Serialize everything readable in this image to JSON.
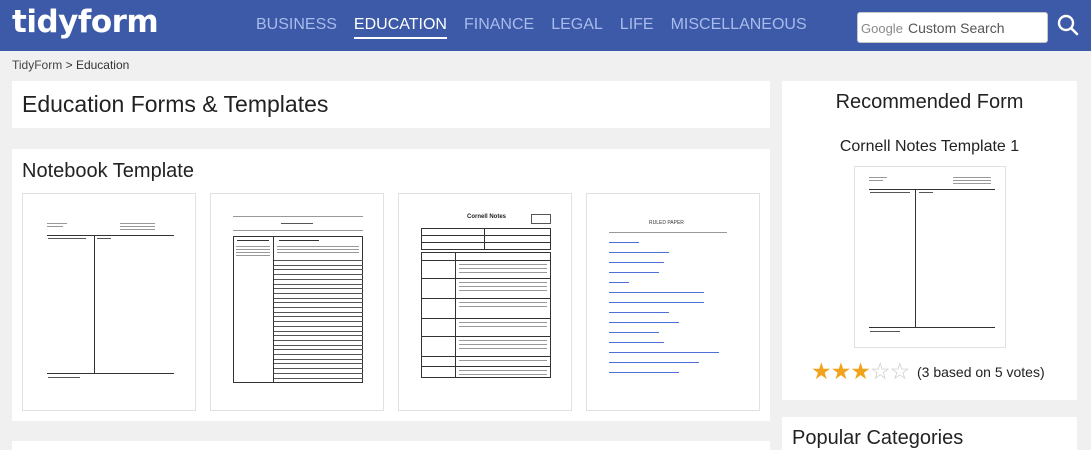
{
  "header": {
    "logo": "tidyform",
    "nav": [
      "BUSINESS",
      "EDUCATION",
      "FINANCE",
      "LEGAL",
      "LIFE",
      "MISCELLANEOUS"
    ],
    "active_nav": "EDUCATION",
    "search": {
      "brand": "Google",
      "placeholder": "Custom Search",
      "icon": "search-icon"
    }
  },
  "breadcrumb": {
    "home": "TidyForm",
    "separator": ">",
    "current": "Education"
  },
  "main": {
    "title": "Education Forms & Templates",
    "section_title": "Notebook Template",
    "thumbnails": [
      {
        "name": "Cornell notes form with questions/summaries column"
      },
      {
        "name": "Cornell Notes reduce & recite record sheet"
      },
      {
        "name": "Cornell Notes section notes worksheet",
        "heading": "Cornell Notes"
      },
      {
        "name": "Ruled paper link list",
        "heading": "RULED PAPER"
      }
    ]
  },
  "sidebar": {
    "recommended_title": "Recommended Form",
    "recommended_name": "Cornell Notes Template 1",
    "rating": {
      "value": 3,
      "max": 5,
      "text": "(3 based on 5 votes)"
    },
    "categories_title": "Popular Categories"
  },
  "colors": {
    "header_bg": "#3c5aa8",
    "nav_inactive": "#a9bbeb",
    "star": "#f0a41d",
    "star_empty": "#c8c8c8",
    "link": "#4e6fd6"
  }
}
